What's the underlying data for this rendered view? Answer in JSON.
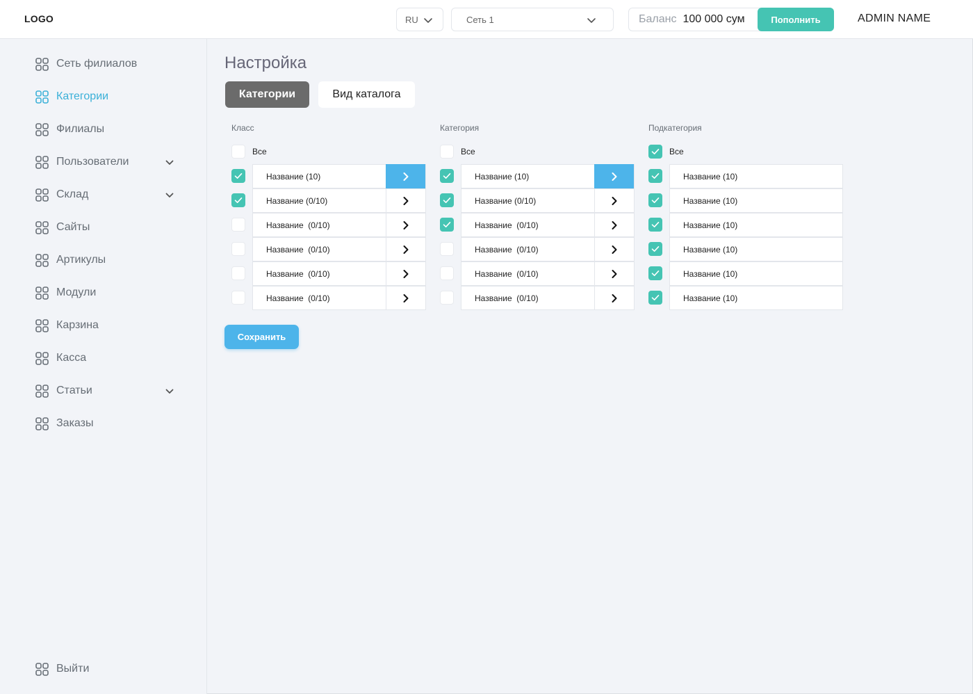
{
  "header": {
    "logo": "LOGO",
    "language": "RU",
    "network": "Сеть 1",
    "balance_label": "Баланс",
    "balance_value": "100 000 сум",
    "topup_label": "Пополнить",
    "admin_name": "ADMIN NAME"
  },
  "sidebar": {
    "items": [
      {
        "label": "Сеть филиалов",
        "active": false,
        "expandable": false
      },
      {
        "label": "Категории",
        "active": true,
        "expandable": false
      },
      {
        "label": "Филиалы",
        "active": false,
        "expandable": false
      },
      {
        "label": "Пользователи",
        "active": false,
        "expandable": true
      },
      {
        "label": "Склад",
        "active": false,
        "expandable": true
      },
      {
        "label": "Сайты",
        "active": false,
        "expandable": false
      },
      {
        "label": "Артикулы",
        "active": false,
        "expandable": false
      },
      {
        "label": "Модули",
        "active": false,
        "expandable": false
      },
      {
        "label": "Карзина",
        "active": false,
        "expandable": false
      },
      {
        "label": "Касса",
        "active": false,
        "expandable": false
      },
      {
        "label": "Статьи",
        "active": false,
        "expandable": true
      },
      {
        "label": "Заказы",
        "active": false,
        "expandable": false
      }
    ],
    "logout_label": "Выйти"
  },
  "main": {
    "title": "Настройка",
    "tabs": [
      {
        "label": "Категории",
        "active": true
      },
      {
        "label": "Вид каталога",
        "active": false
      }
    ],
    "columns": [
      {
        "title": "Класс",
        "all_label": "Все",
        "all_checked": false,
        "rows": [
          {
            "label": "Название (10)",
            "checked": true,
            "selected": true
          },
          {
            "label": "Название (0/10)",
            "checked": true,
            "selected": false
          },
          {
            "label": "Название  (0/10)",
            "checked": false,
            "selected": false
          },
          {
            "label": "Название  (0/10)",
            "checked": false,
            "selected": false
          },
          {
            "label": "Название  (0/10)",
            "checked": false,
            "selected": false
          },
          {
            "label": "Название  (0/10)",
            "checked": false,
            "selected": false
          }
        ]
      },
      {
        "title": "Категория",
        "all_label": "Все",
        "all_checked": false,
        "rows": [
          {
            "label": "Название (10)",
            "checked": true,
            "selected": true
          },
          {
            "label": "Название (0/10)",
            "checked": true,
            "selected": false
          },
          {
            "label": "Название  (0/10)",
            "checked": true,
            "selected": false
          },
          {
            "label": "Название  (0/10)",
            "checked": false,
            "selected": false
          },
          {
            "label": "Название  (0/10)",
            "checked": false,
            "selected": false
          },
          {
            "label": "Название  (0/10)",
            "checked": false,
            "selected": false
          }
        ]
      },
      {
        "title": "Подкатегория",
        "all_label": "Все",
        "all_checked": true,
        "rows": [
          {
            "label": "Название (10)",
            "checked": true
          },
          {
            "label": "Название (10)",
            "checked": true
          },
          {
            "label": "Название (10)",
            "checked": true
          },
          {
            "label": "Название (10)",
            "checked": true
          },
          {
            "label": "Название (10)",
            "checked": true
          },
          {
            "label": "Название (10)",
            "checked": true
          }
        ]
      }
    ],
    "save_label": "Сохранить"
  },
  "colors": {
    "accent_teal": "#45c4b3",
    "accent_blue": "#4db4ea",
    "active_nav": "#3ab0d8",
    "tab_active_bg": "#6b6b6b"
  }
}
